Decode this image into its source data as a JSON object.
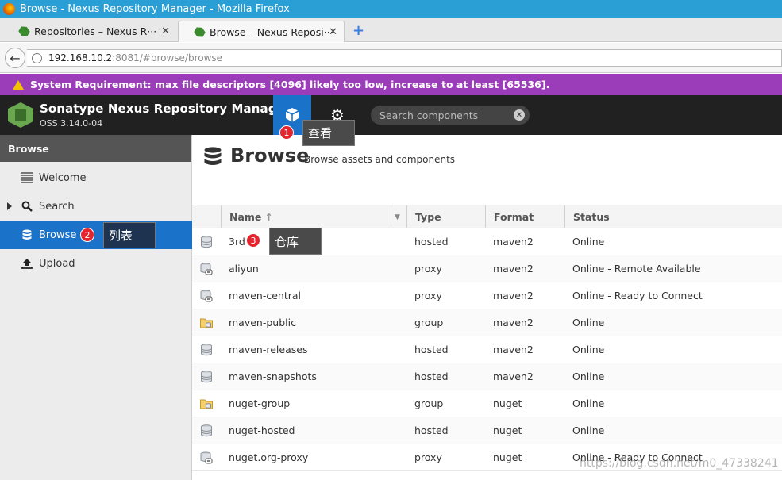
{
  "window": {
    "title": "Browse - Nexus Repository Manager - Mozilla Firefox"
  },
  "tabs": [
    {
      "label": "Repositories – Nexus R···",
      "active": false
    },
    {
      "label": "Browse – Nexus Reposi···",
      "active": true
    }
  ],
  "url": {
    "host": "192.168.10.2",
    "rest": ":8081/#browse/browse"
  },
  "warning": {
    "text": "System Requirement: max file descriptors [4096] likely too low, increase to at least [65536]."
  },
  "header": {
    "app_title": "Sonatype Nexus Repository Manager",
    "version": "OSS 3.14.0-04",
    "search_placeholder": "Search components"
  },
  "sidebar": {
    "heading": "Browse",
    "items": [
      {
        "label": "Welcome"
      },
      {
        "label": "Search"
      },
      {
        "label": "Browse"
      },
      {
        "label": "Upload"
      }
    ]
  },
  "page": {
    "title": "Browse",
    "subtitle": "Browse assets and components"
  },
  "table": {
    "columns": {
      "name": "Name",
      "type": "Type",
      "format": "Format",
      "status": "Status"
    },
    "rows": [
      {
        "name": "3rd",
        "type": "hosted",
        "format": "maven2",
        "status": "Online",
        "icon": "hosted"
      },
      {
        "name": "aliyun",
        "type": "proxy",
        "format": "maven2",
        "status": "Online - Remote Available",
        "icon": "proxy"
      },
      {
        "name": "maven-central",
        "type": "proxy",
        "format": "maven2",
        "status": "Online - Ready to Connect",
        "icon": "proxy"
      },
      {
        "name": "maven-public",
        "type": "group",
        "format": "maven2",
        "status": "Online",
        "icon": "group"
      },
      {
        "name": "maven-releases",
        "type": "hosted",
        "format": "maven2",
        "status": "Online",
        "icon": "hosted"
      },
      {
        "name": "maven-snapshots",
        "type": "hosted",
        "format": "maven2",
        "status": "Online",
        "icon": "hosted"
      },
      {
        "name": "nuget-group",
        "type": "group",
        "format": "nuget",
        "status": "Online",
        "icon": "group"
      },
      {
        "name": "nuget-hosted",
        "type": "hosted",
        "format": "nuget",
        "status": "Online",
        "icon": "hosted"
      },
      {
        "name": "nuget.org-proxy",
        "type": "proxy",
        "format": "nuget",
        "status": "Online - Ready to Connect",
        "icon": "proxy"
      }
    ]
  },
  "annotations": [
    {
      "num": "1",
      "text": "查看"
    },
    {
      "num": "2",
      "text": "列表"
    },
    {
      "num": "3",
      "text": "仓库"
    }
  ],
  "watermark": "https://blog.csdn.net/m0_47338241",
  "colors": {
    "accent": "#1a73c8",
    "warning": "#9b3db8",
    "header": "#212121",
    "badge": "#e3262d"
  }
}
